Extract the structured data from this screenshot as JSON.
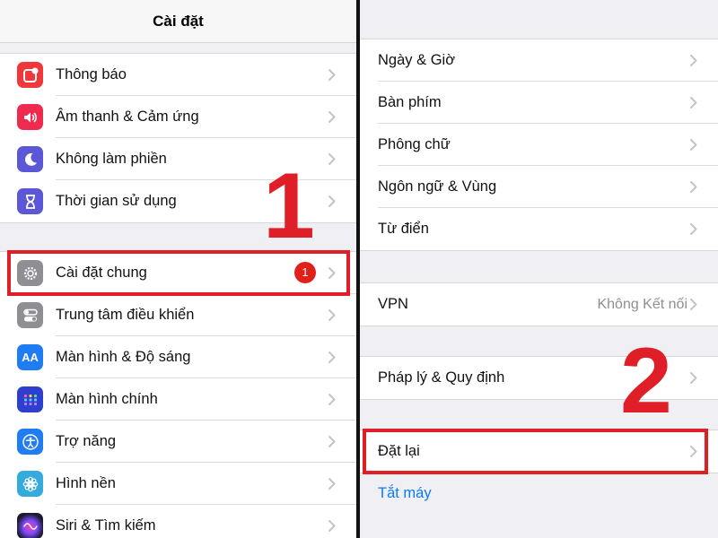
{
  "left": {
    "title": "Cài đặt",
    "group1": [
      {
        "label": "Thông báo",
        "icon": "notification-icon",
        "color": "#f0373a"
      },
      {
        "label": "Âm thanh & Cảm ứng",
        "icon": "speaker-icon",
        "color": "#ee2b4f"
      },
      {
        "label": "Không làm phiền",
        "icon": "moon-icon",
        "color": "#5b57d6"
      },
      {
        "label": "Thời gian sử dụng",
        "icon": "hourglass-icon",
        "color": "#5b57d6"
      }
    ],
    "group2": [
      {
        "label": "Cài đặt chung",
        "icon": "gear-icon",
        "color": "#8e8e93",
        "badge": "1"
      },
      {
        "label": "Trung tâm điều khiển",
        "icon": "toggles-icon",
        "color": "#8e8e93"
      },
      {
        "label": "Màn hình & Độ sáng",
        "icon": "text-size-icon",
        "color": "#1f7cf2",
        "glyph": "AA"
      },
      {
        "label": "Màn hình chính",
        "icon": "home-grid-icon",
        "color": "#2d3fcf"
      },
      {
        "label": "Trợ năng",
        "icon": "accessibility-icon",
        "color": "#1f7cf2"
      },
      {
        "label": "Hình nền",
        "icon": "flower-icon",
        "color": "#35aadc"
      },
      {
        "label": "Siri & Tìm kiếm",
        "icon": "siri-icon",
        "color": "#222233"
      }
    ],
    "step": "1"
  },
  "right": {
    "group1": [
      "Ngày & Giờ",
      "Bàn phím",
      "Phông chữ",
      "Ngôn ngữ & Vùng",
      "Từ điển"
    ],
    "vpn": {
      "label": "VPN",
      "detail": "Không Kết nối"
    },
    "legal": "Pháp lý & Quy định",
    "reset": "Đặt lại",
    "shutdown": "Tắt máy",
    "step": "2"
  },
  "colors": {
    "highlight": "#e01e28",
    "link": "#0a7aff",
    "badge": "#e0211b"
  }
}
